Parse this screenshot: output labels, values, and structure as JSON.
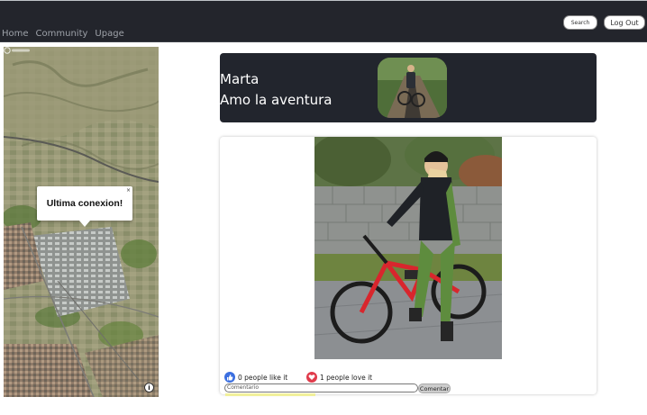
{
  "nav": {
    "links": [
      "Home",
      "Community",
      "Upage"
    ],
    "search_label": "Search",
    "logout_label": "Log Out"
  },
  "map": {
    "popup_text": "Ultima conexion!",
    "close_label": "×",
    "info_label": "i",
    "logo_icon": "mapbox-logo-icon"
  },
  "profile": {
    "name": "Marta",
    "bio": "Amo la aventura"
  },
  "post": {
    "likes_text": "0 people like it",
    "loves_text": "1 people love it",
    "like_icon": "thumbs-up-icon",
    "love_icon": "heart-icon",
    "like_color": "#3b6fe0",
    "love_color": "#e03b4b",
    "comment_placeholder": "Comentario",
    "comment_button": "Comentar"
  }
}
